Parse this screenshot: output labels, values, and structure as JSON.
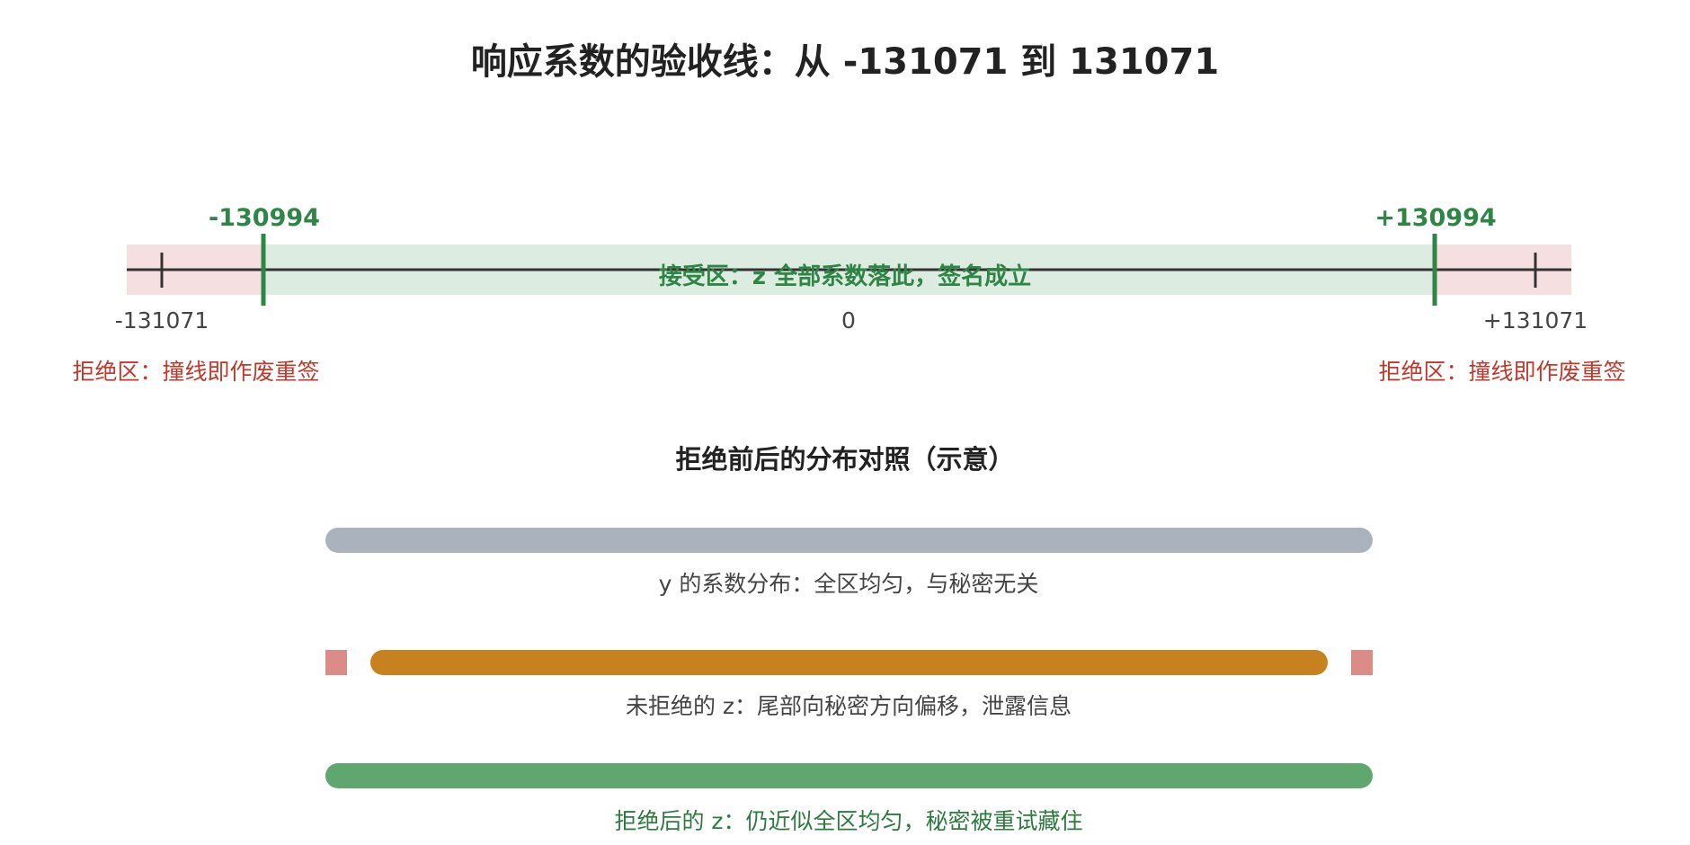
{
  "title": "响应系数的验收线：从 -131071 到 131071",
  "number_line": {
    "outer_min_label": "-131071",
    "outer_max_label": "+131071",
    "zero_label": "0",
    "inner_min_label": "-130994",
    "inner_max_label": "+130994",
    "accept_zone_label": "接受区：z 全部系数落此，签名成立",
    "reject_zone_label_left": "拒绝区：撞线即作废重签",
    "reject_zone_label_right": "拒绝区：撞线即作废重签"
  },
  "colors": {
    "reject_zone": "#f5e0df",
    "accept_zone": "#dcece0",
    "bound_line": "#2e8545",
    "axis": "#333333",
    "bar_y": "#aab3bd",
    "bar_z_unrejected": "#c8811f",
    "bar_z_tail": "#dc8c87",
    "bar_z_rejected": "#5fa76f",
    "text_red": "#c0392b",
    "text_green": "#2e8545"
  },
  "comparison": {
    "title": "拒绝前后的分布对照（示意）",
    "rows": [
      {
        "caption": "y 的系数分布：全区均匀，与秘密无关"
      },
      {
        "caption": "未拒绝的 z：尾部向秘密方向偏移，泄露信息"
      },
      {
        "caption": "拒绝后的 z：仍近似全区均匀，秘密被重试藏住"
      }
    ]
  }
}
